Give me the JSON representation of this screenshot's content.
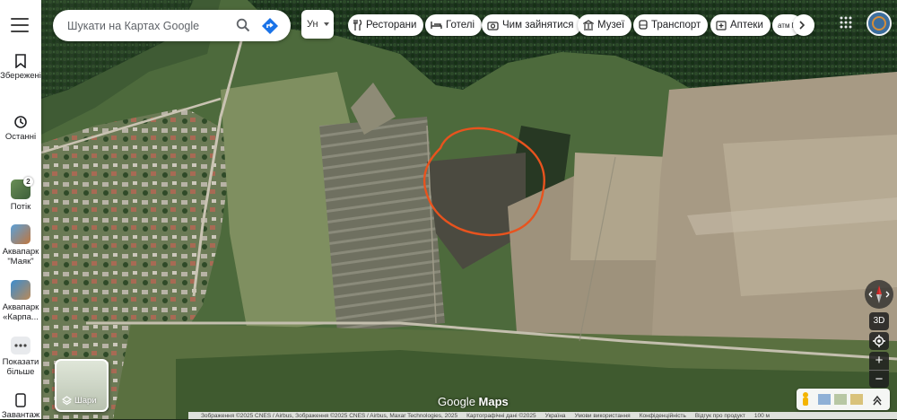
{
  "search": {
    "placeholder": "Шукати на Картах Google"
  },
  "language": {
    "label": "Ун"
  },
  "chips": [
    {
      "label": "Ресторани",
      "icon": "fork-knife-icon"
    },
    {
      "label": "Готелі",
      "icon": "bed-icon"
    },
    {
      "label": "Чим зайнятися",
      "icon": "camera-icon"
    },
    {
      "label": "Музеї",
      "icon": "museum-icon"
    },
    {
      "label": "Транспорт",
      "icon": "bus-icon"
    },
    {
      "label": "Аптеки",
      "icon": "pharmacy-icon"
    },
    {
      "label": "атм Б",
      "icon": "atm-icon"
    }
  ],
  "rail": {
    "saved": "Збережені",
    "recent": "Останні",
    "items": [
      {
        "label": "Потік",
        "badge": "2"
      },
      {
        "label": "Аквапарк \"Маяк\""
      },
      {
        "label": "Аквапарк «Карпа..."
      }
    ],
    "more": "Показати більше",
    "download": "Завантаж"
  },
  "layers": {
    "label": "Шари"
  },
  "controls": {
    "view3d": "3D"
  },
  "logo": {
    "google": "Google",
    "maps": "Maps"
  },
  "footer": [
    "Зображення ©2025 CNES / Airbus, Зображення ©2025 CNES / Airbus, Maxar Technologies, 2025",
    "Картографічні дані ©2025",
    "Україна",
    "Умови використання",
    "Конфіденційність",
    "Відгук про продукт",
    "100 м"
  ],
  "colors": {
    "annotation_circle": "#e8531e",
    "google_blue": "#1a73e8"
  }
}
